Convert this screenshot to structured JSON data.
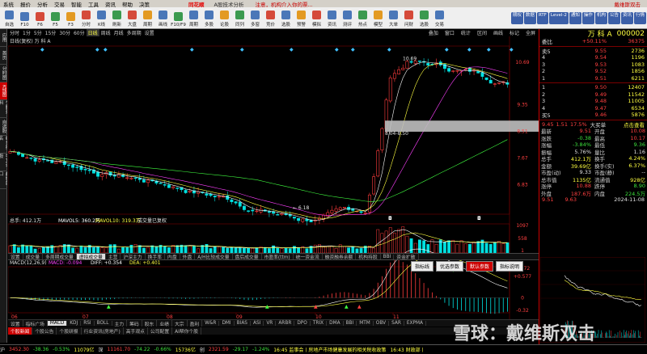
{
  "menubar": {
    "items": [
      "系统",
      "报价",
      "分析",
      "交易",
      "智能",
      "工具",
      "资讯",
      "帮助",
      "决策"
    ],
    "brand": "同花顺",
    "window_title": "A股技术分析",
    "warning": "注意，机构介入你的票...",
    "notice": "戴维斯双击"
  },
  "toolbar": {
    "buttons": [
      "自选",
      "F10",
      "F6",
      "F5",
      "F3",
      "分时",
      "K线",
      "刷新",
      "大盘",
      "周期",
      "画线",
      "F10/F9",
      "周期",
      "多股",
      "论股",
      "同列",
      "多窗",
      "竞价",
      "选股",
      "预警",
      "模拟",
      "资讯",
      "测评",
      "热点",
      "模型",
      "大单",
      "问财",
      "选股",
      "交易"
    ],
    "right_buttons": [
      "期权",
      "数据",
      "RTF",
      "Level-2",
      "通知",
      "操作",
      "机构",
      "公告",
      "资讯",
      "行情"
    ]
  },
  "left_tabs": [
    "应用",
    "首页",
    "分时图",
    "K线图",
    "个股资料",
    "自选股",
    "综合排名",
    "牛叉诊股",
    "超级盘口"
  ],
  "period_bar": {
    "items": [
      "分时",
      "1分",
      "5分",
      "15分",
      "30分",
      "60分",
      "日线",
      "周线",
      "月线",
      "多周期",
      "设置"
    ],
    "selected": "日线",
    "right_items": [
      "叠加",
      "窗口",
      "统计",
      "区间",
      "画线",
      "标记",
      "全屏"
    ]
  },
  "chart_title": "日线(复权) 万 科 A",
  "indicator_tabs": {
    "items": [
      "设置",
      "成交量",
      "多周期成交量",
      "虚拟成交量",
      "主营",
      "沪深主力",
      "换手率",
      "内盘",
      "外盘",
      "A/H比较成交量",
      "盘后成交量",
      "市盈率(ttm)",
      "统一资金流",
      "融资融券余额",
      "机构持股",
      "BBI",
      "资金扩散"
    ],
    "selected": "虚拟成交量"
  },
  "panel_buttons": {
    "items": [
      "指标线",
      "优选参数",
      "默认参数",
      "指标说明"
    ],
    "selected": "默认参数"
  },
  "volume_label": {
    "name": "总手: 412.1万",
    "ma5": "MAVOL5: 360.2万",
    "ma10": "MAVOL10: 319.3万",
    "note": "成交量已复权"
  },
  "macd_label": {
    "name": "MACD(12,26,9)",
    "macd": "MACD: -0.094",
    "diff": "DIFF: +0.354",
    "dea": "DEA: +0.401"
  },
  "tab_row1": {
    "items": [
      "设置",
      "指标广场",
      "MACD",
      "KDJ",
      "RSI",
      "BOLL",
      "主力",
      "筹码",
      "股东",
      "业绩",
      "大宗",
      "盈利",
      "W&R",
      "DMI",
      "BIAS",
      "ASI",
      "VR",
      "ARBR",
      "DPO",
      "TRIX",
      "DMA",
      "BBI",
      "MTM",
      "OBV",
      "SAR",
      "EXPMA"
    ],
    "selected": "MACD"
  },
  "tab_row2": {
    "items": [
      "个股新闻",
      "个股公告",
      "个股研报",
      "行业资讯(房地产)",
      "高手观点",
      "公司配置",
      "AI帮你个股"
    ],
    "selected": "个股新闻"
  },
  "status_bar": {
    "items": [
      {
        "t": "沪",
        "c": "wt"
      },
      {
        "t": "3452.30",
        "c": "rd"
      },
      {
        "t": "-38.36",
        "c": "gn"
      },
      {
        "t": "-0.53%",
        "c": "gn"
      },
      {
        "t": "11079亿",
        "c": "yl"
      },
      {
        "t": "深",
        "c": "wt"
      },
      {
        "t": "11161.70",
        "c": "rd"
      },
      {
        "t": "-74.22",
        "c": "gn"
      },
      {
        "t": "-0.66%",
        "c": "gn"
      },
      {
        "t": "15736亿",
        "c": "yl"
      },
      {
        "t": "创",
        "c": "wt"
      },
      {
        "t": "2321.59",
        "c": "rd"
      },
      {
        "t": "-29.17",
        "c": "gn"
      },
      {
        "t": "-1.24%",
        "c": "gn"
      },
      {
        "t": "16:45 监事会丨房地产市场健康发展的相关税收政策",
        "c": "yl"
      },
      {
        "t": "16:43 财政部丨",
        "c": "yl"
      }
    ]
  },
  "right_panel": {
    "stock_name": "万 科 A",
    "stock_code": "000002",
    "weibi": "委比",
    "weibi_val": "+50.11%",
    "weicha_val": "36375",
    "sells": [
      {
        "l": "卖5",
        "p": "9.55",
        "v": "2736"
      },
      {
        "l": "4",
        "p": "9.54",
        "v": "1196"
      },
      {
        "l": "3",
        "p": "9.53",
        "v": "1083"
      },
      {
        "l": "2",
        "p": "9.52",
        "v": "1856"
      },
      {
        "l": "1",
        "p": "9.51",
        "v": "6211"
      }
    ],
    "buys": [
      {
        "l": "1",
        "p": "9.50",
        "v": "12407"
      },
      {
        "l": "2",
        "p": "9.49",
        "v": "11542"
      },
      {
        "l": "3",
        "p": "9.48",
        "v": "11005"
      },
      {
        "l": "4",
        "p": "9.47",
        "v": "6534"
      },
      {
        "l": "买5",
        "p": "9.46",
        "v": "5876"
      }
    ],
    "quote_header": {
      "price": "9.45",
      "chg": "1.51",
      "pct": "17.5%",
      "hint": "大买单",
      "link": "点击查看"
    },
    "stats": [
      {
        "k": "最新",
        "v": "9.51",
        "k2": "开盘",
        "v2": "10.08",
        "c": "rd",
        "c2": "rd"
      },
      {
        "k": "涨跌",
        "v": "-0.38",
        "k2": "最高",
        "v2": "10.17",
        "c": "gn",
        "c2": "rd"
      },
      {
        "k": "涨幅",
        "v": "-3.84%",
        "k2": "最低",
        "v2": "9.36",
        "c": "gn",
        "c2": "gn"
      },
      {
        "k": "振幅",
        "v": "5.76%",
        "k2": "量比",
        "v2": "1.16",
        "c": "wt",
        "c2": "wt"
      },
      {
        "k": "总手",
        "v": "412.1万",
        "k2": "换手",
        "v2": "4.24%",
        "c": "yl",
        "c2": "yl"
      },
      {
        "k": "金额",
        "v": "39.69亿",
        "k2": "换手(实)",
        "v2": "6.37%",
        "c": "yl",
        "c2": "yl"
      },
      {
        "k": "市盈(动)",
        "v": "9.33",
        "k2": "市盈(静)",
        "v2": "--",
        "c": "wt",
        "c2": "wt"
      },
      {
        "k": "总市值",
        "v": "1135亿",
        "k2": "流通值",
        "v2": "928亿",
        "c": "yl",
        "c2": "yl"
      },
      {
        "k": "涨停",
        "v": "10.88",
        "k2": "跌停",
        "v2": "8.90",
        "c": "rd",
        "c2": "gn"
      },
      {
        "k": "外盘",
        "v": "187.6万",
        "k2": "内盘",
        "v2": "224.5万",
        "c": "rd",
        "c2": "gn"
      }
    ],
    "mini_header": {
      "a": "9.51",
      "b": "9.63",
      "date": "2024-11-08"
    }
  },
  "watermark": "雪球：戴维斯双击",
  "kline": {
    "price_labels": [
      "10.69",
      "9.35",
      "8.51",
      "7.67",
      "6.83",
      "6.18",
      "8.04-8.50"
    ],
    "date_labels": [
      "06",
      "07",
      "08",
      "09",
      "10",
      "11"
    ],
    "vol_labels": [
      "1097",
      "558",
      "1"
    ],
    "macd_labels": [
      "+0.72",
      "+0.577",
      "0",
      "-0.32"
    ]
  },
  "colors": {
    "up": "#ff3c3c",
    "down": "#00e0e0",
    "ma5": "#ffffff",
    "ma10": "#ffff40",
    "accent": "#c00000"
  }
}
